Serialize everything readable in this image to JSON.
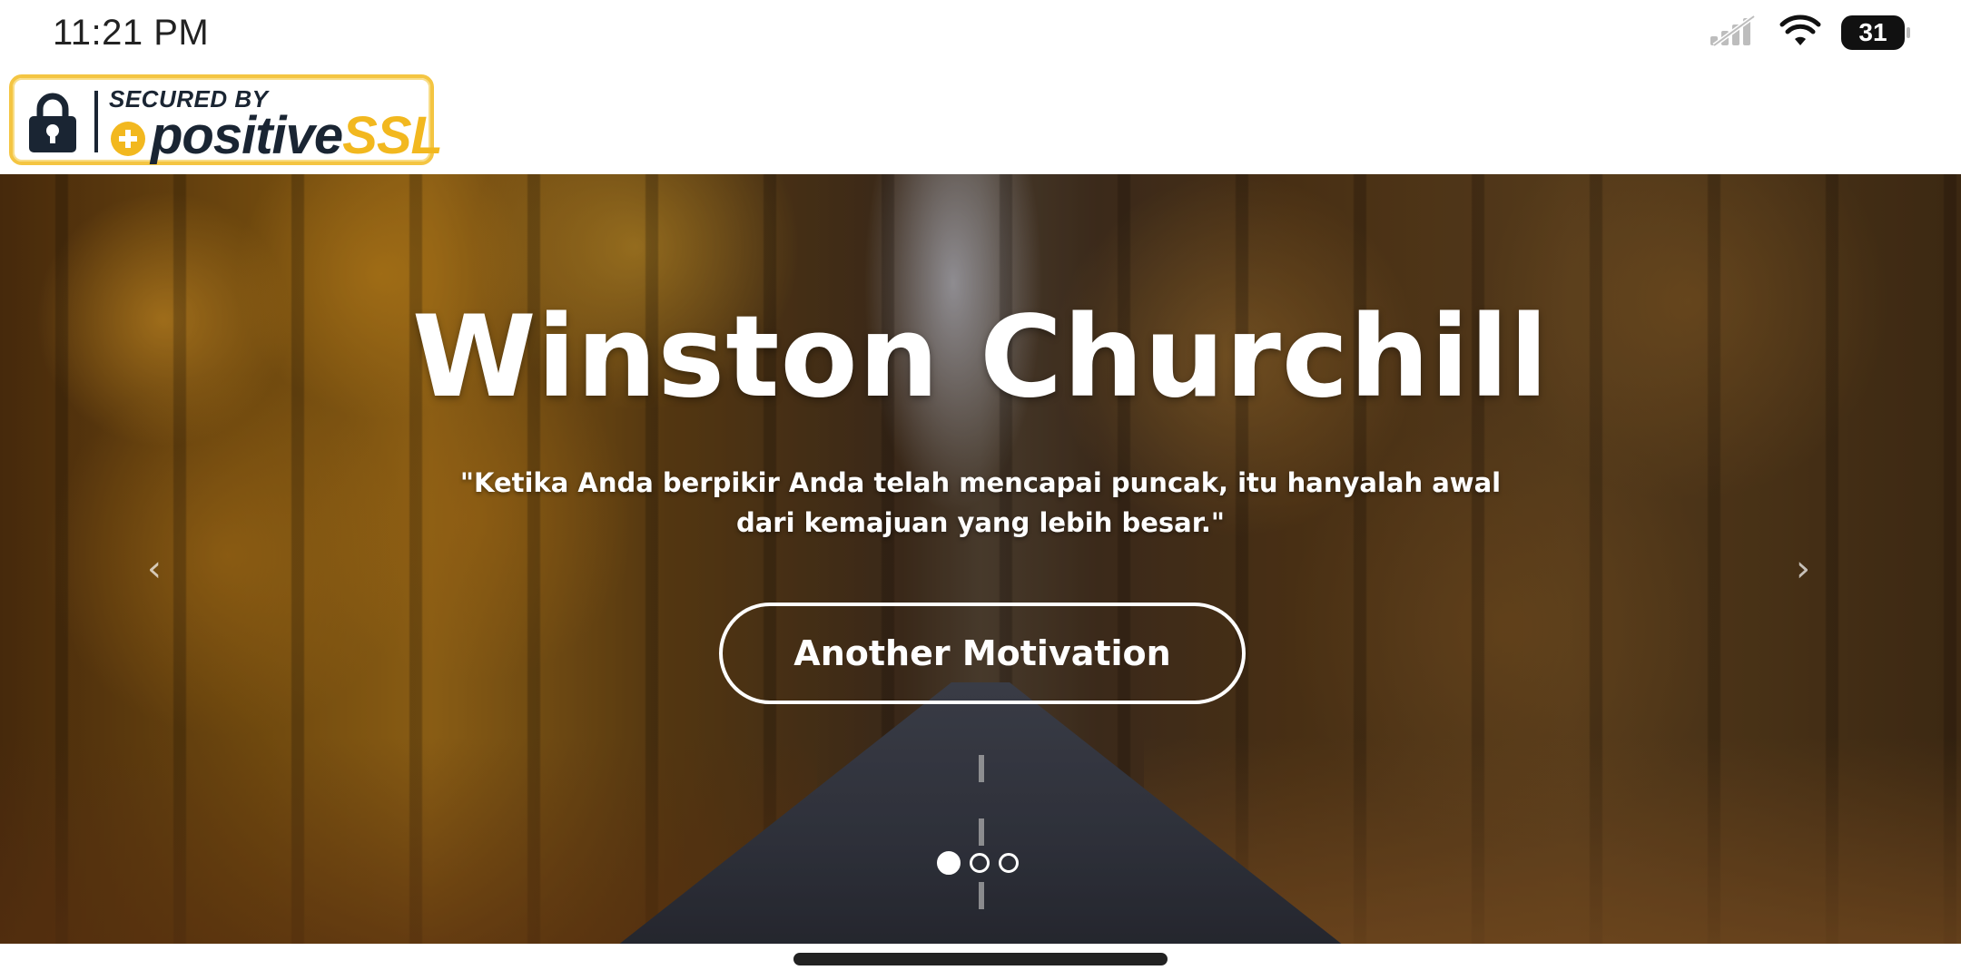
{
  "status_bar": {
    "time": "11:21 PM",
    "battery_level": "31",
    "icons": [
      "no-signal-icon",
      "wifi-icon",
      "battery-icon"
    ]
  },
  "ssl_badge": {
    "secured_by": "SECURED BY",
    "brand_primary": "positive",
    "brand_secondary": "SSL",
    "colors": {
      "navy": "#1a2533",
      "gold": "#f2b81f"
    }
  },
  "hero": {
    "title": "Winston Churchill",
    "quote": "\"Ketika Anda berpikir Anda telah mencapai puncak, itu hanyalah awal dari kemajuan yang lebih besar.\"",
    "button_label": "Another Motivation",
    "prev_arrow": "‹",
    "next_arrow": "›",
    "slides_total": 3,
    "active_slide": 1
  }
}
